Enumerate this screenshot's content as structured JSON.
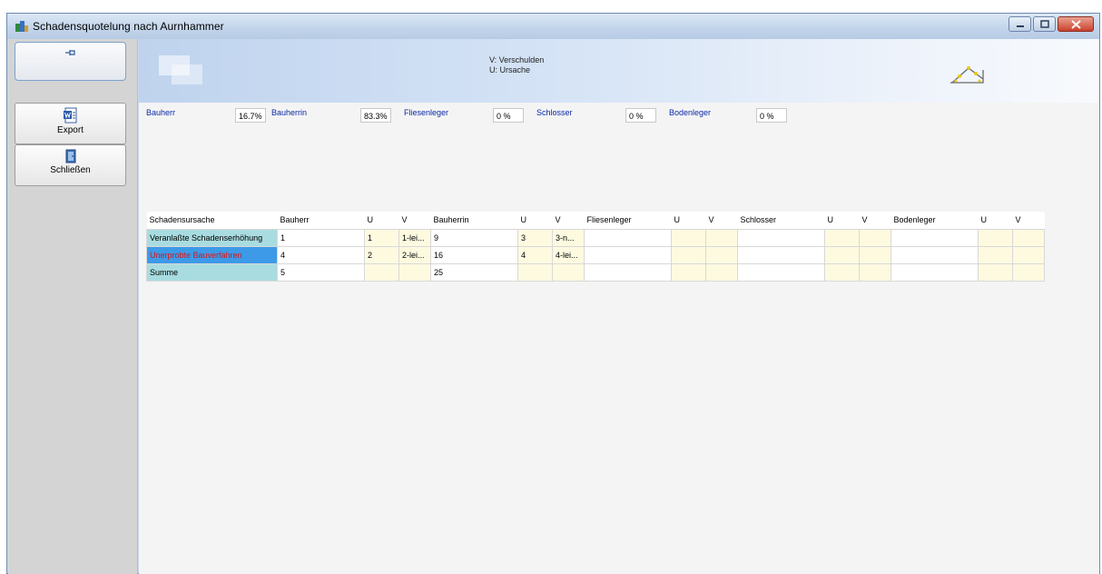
{
  "window": {
    "title": "Schadensquotelung nach Aurnhammer",
    "buttons": {
      "minimize": "minimize-icon",
      "maximize": "maximize-icon",
      "close": "close-icon"
    }
  },
  "sidebar": {
    "pin_icon": "pin-icon",
    "export_label": "Export",
    "close_label": "Schließen"
  },
  "banner": {
    "legend_line1": "V: Verschulden",
    "legend_line2": "U: Ursache"
  },
  "quotas": [
    {
      "label": "Bauherr",
      "value": "16.7%"
    },
    {
      "label": "Bauherrin",
      "value": "83.3%"
    },
    {
      "label": "Fliesenleger",
      "value": "0 %"
    },
    {
      "label": "Schlosser",
      "value": "0 %"
    },
    {
      "label": "Bodenleger",
      "value": "0 %"
    }
  ],
  "table": {
    "headers": [
      "Schadensursache",
      "Bauherr",
      "U",
      "V",
      "Bauherrin",
      "U",
      "V",
      "Fliesenleger",
      "U",
      "V",
      "Schlosser",
      "U",
      "V",
      "Bodenleger",
      "U",
      "V"
    ],
    "rows": [
      [
        "Veranlaßte Schadenserhöhung",
        "1",
        "1",
        "1-lei...",
        "9",
        "3",
        "3-n...",
        "",
        "",
        "",
        "",
        "",
        "",
        "",
        "",
        ""
      ],
      [
        "Unerprobte Bauverfahren",
        "4",
        "2",
        "2-lei...",
        "16",
        "4",
        "4-lei...",
        "",
        "",
        "",
        "",
        "",
        "",
        "",
        "",
        ""
      ],
      [
        "Summe",
        "5",
        "",
        "",
        "25",
        "",
        "",
        "",
        "",
        "",
        "",
        "",
        "",
        "",
        "",
        ""
      ]
    ]
  },
  "colors": {
    "accent": "#0b2aa8",
    "cause_cell": "#a8dce0",
    "selected_cell": "#3d9ae8",
    "uv_cell": "#fdfae0"
  }
}
